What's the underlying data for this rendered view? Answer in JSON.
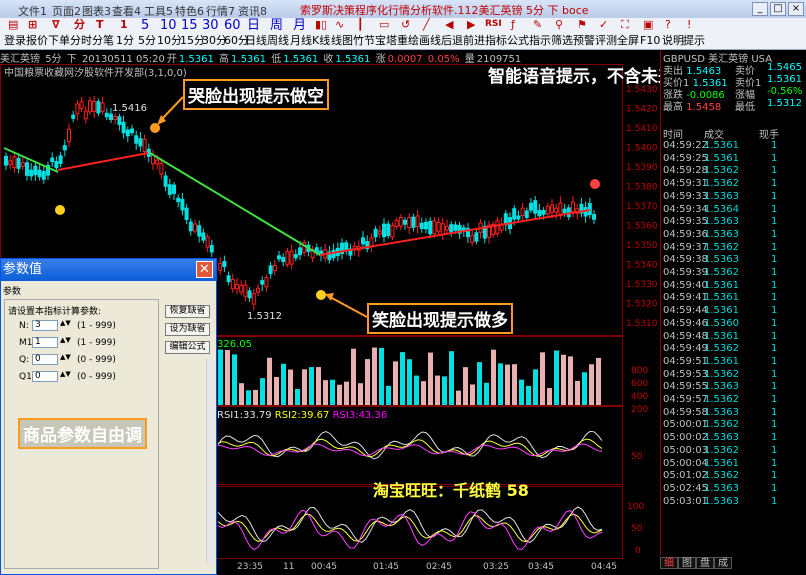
{
  "titlebar": {
    "menu": [
      "文件1",
      "页面2",
      "图表3",
      "查看4",
      "工具5",
      "特色6",
      "行情7",
      "资讯8"
    ],
    "title": "索罗斯决策程序化行情分析软件.112美汇英镑 5分 下 boce"
  },
  "toolbar": {
    "items": [
      "登录",
      "报价",
      "下单",
      "分时",
      "分笔",
      "1分",
      "5分",
      "10分",
      "15分",
      "30分",
      "60分",
      "日线",
      "周线",
      "月线",
      "K线",
      "线图",
      "竹节",
      "宝塔",
      "重绘",
      "画线",
      "后退",
      "前进",
      "指标",
      "公式",
      "指示",
      "筛选",
      "预警",
      "评测",
      "全屏",
      "F10",
      "说明",
      "提示"
    ],
    "periods": [
      "5",
      "10",
      "15",
      "30",
      "60",
      "日",
      "周",
      "月"
    ]
  },
  "info": {
    "symbol": "美汇英镑",
    "period": "5分",
    "dir": "下",
    "datetime": "20130511 05:20",
    "open_label": "开",
    "open": "1.5361",
    "high_label": "高",
    "high": "1.5361",
    "low_label": "低",
    "low": "1.5361",
    "close_label": "收",
    "close": "1.5361",
    "change_label": "涨",
    "change": "0.0007",
    "pct": "0.05%",
    "vol_label": "量",
    "vol": "2109751"
  },
  "chart_title": "中国粮票收藏网汐股软件开发部",
  "chart_title_args": "(3,1,0,0)",
  "price_labels": [
    "1.5430",
    "1.5420",
    "1.5410",
    "1.5400",
    "1.5390",
    "1.5380",
    "1.5370",
    "1.5360",
    "1.5350",
    "1.5340",
    "1.5330",
    "1.5320",
    "1.5310"
  ],
  "high_mark": "1.5416",
  "low_mark": "1.5312",
  "vol_indicator_label": "326.05",
  "vol_labels": [
    "800",
    "600",
    "400",
    "200"
  ],
  "rsi": {
    "rsi1": "RSI1:33.79",
    "rsi2": "RSI2:39.67",
    "rsi3": "RSI3:43.36",
    "labels": [
      "50"
    ]
  },
  "kd_labels": [
    "100",
    "50",
    "0"
  ],
  "xaxis": [
    "23:35",
    "11",
    "00:45",
    "01:45",
    "02:45",
    "03:25",
    "03:45",
    "04:45"
  ],
  "annotations": {
    "top_right": "智能语音提示，不含未来函数",
    "cry": "哭脸出现提示做空",
    "smile": "笑脸出现提示做多",
    "params": "商品参数自由调",
    "taobao": "淘宝旺旺：千纸鹤 58"
  },
  "panel": {
    "header": "GBPUSD 美汇英镑 USA",
    "quote": [
      [
        "卖出",
        "1.5463",
        "卖价",
        "1.5465"
      ],
      [
        "买价1",
        "1.5361",
        "卖价1",
        "1.5361"
      ],
      [
        "涨跌",
        "-0.0086",
        "涨幅",
        "-0.56%"
      ],
      [
        "最高",
        "1.5458",
        "最低",
        "1.5312"
      ]
    ],
    "col_time": "时间",
    "col_trade": "成交",
    "col_now": "现手",
    "ticks": [
      [
        "04:59:22",
        "1.5361",
        "1"
      ],
      [
        "04:59:25",
        "1.5361",
        "1"
      ],
      [
        "04:59:28",
        "1.5362",
        "1"
      ],
      [
        "04:59:31",
        "1.5362",
        "1"
      ],
      [
        "04:59:33",
        "1.5363",
        "1"
      ],
      [
        "04:59:34",
        "1.5364",
        "1"
      ],
      [
        "04:59:35",
        "1.5363",
        "1"
      ],
      [
        "04:59:36",
        "1.5363",
        "1"
      ],
      [
        "04:59:37",
        "1.5362",
        "1"
      ],
      [
        "04:59:38",
        "1.5363",
        "1"
      ],
      [
        "04:59:39",
        "1.5362",
        "1"
      ],
      [
        "04:59:40",
        "1.5361",
        "1"
      ],
      [
        "04:59:41",
        "1.5361",
        "1"
      ],
      [
        "04:59:44",
        "1.5361",
        "1"
      ],
      [
        "04:59:46",
        "1.5360",
        "1"
      ],
      [
        "04:59:48",
        "1.5361",
        "1"
      ],
      [
        "04:59:49",
        "1.5362",
        "1"
      ],
      [
        "04:59:51",
        "1.5361",
        "1"
      ],
      [
        "04:59:53",
        "1.5362",
        "1"
      ],
      [
        "04:59:55",
        "1.5363",
        "1"
      ],
      [
        "04:59:57",
        "1.5362",
        "1"
      ],
      [
        "04:59:58",
        "1.5363",
        "1"
      ],
      [
        "05:00:01",
        "1.5362",
        "1"
      ],
      [
        "05:00:02",
        "1.5363",
        "1"
      ],
      [
        "05:00:03",
        "1.5362",
        "1"
      ],
      [
        "05:00:04",
        "1.5361",
        "1"
      ],
      [
        "05:01:02",
        "1.5362",
        "1"
      ],
      [
        "05:02:45",
        "1.5363",
        "1"
      ],
      [
        "05:03:01",
        "1.5363",
        "1"
      ]
    ],
    "tabs": [
      "细",
      "图",
      "盘",
      "成"
    ]
  },
  "dialog": {
    "title": "参数值",
    "tab": "参数",
    "group_label": "请设置本指标计算参数:",
    "params": [
      {
        "name": "N:",
        "value": "3",
        "range": "(1 - 999)"
      },
      {
        "name": "M1:",
        "value": "1",
        "range": "(1 - 999)"
      },
      {
        "name": "Q:",
        "value": "0",
        "range": "(0 - 999)"
      },
      {
        "name": "Q1:",
        "value": "0",
        "range": "(0 - 999)"
      }
    ],
    "btn_default": "恢复缺省",
    "btn_set_default": "设为缺省",
    "btn_edit": "编辑公式"
  },
  "colors": {
    "up": "#ff2020",
    "down": "#00e0e0",
    "green": "#40e040",
    "orange": "#ff9a20",
    "yellow": "#ffff40"
  }
}
